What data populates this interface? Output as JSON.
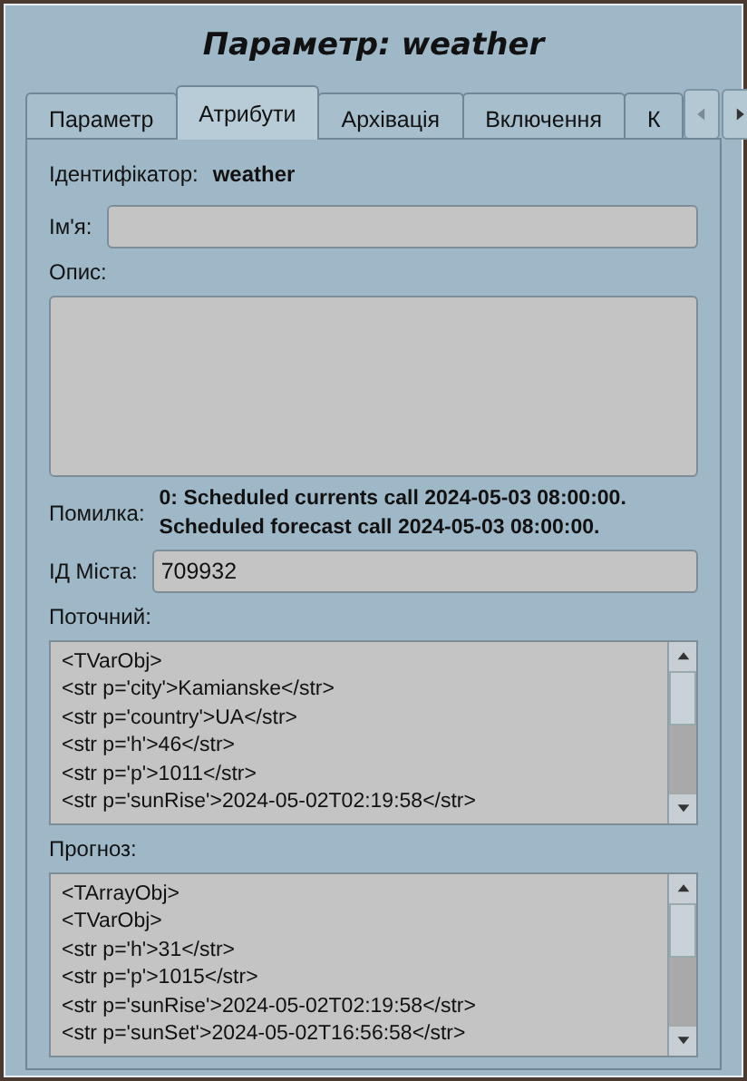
{
  "window": {
    "title": "Параметр: weather"
  },
  "tabs": [
    {
      "label": "Параметр",
      "selected": false
    },
    {
      "label": "Атрибути",
      "selected": true
    },
    {
      "label": "Архівація",
      "selected": false
    },
    {
      "label": "Включення",
      "selected": false
    },
    {
      "label": "К",
      "selected": false
    }
  ],
  "identifier": {
    "label": "Ідентифікатор:",
    "value": "weather"
  },
  "name": {
    "label": "Ім'я:"
  },
  "description": {
    "label": "Опис:"
  },
  "error": {
    "label": "Помилка:",
    "lines": [
      "0: Scheduled currents call 2024-05-03 08:00:00.",
      "Scheduled forecast call 2024-05-03 08:00:00."
    ]
  },
  "city_id": {
    "label": "ІД Міста:",
    "value": "709932"
  },
  "current": {
    "label": "Поточний:",
    "lines": [
      "<TVarObj>",
      "<str p='city'>Kamianske</str>",
      "<str p='country'>UA</str>",
      "<str p='h'>46</str>",
      "<str p='p'>1011</str>",
      "<str p='sunRise'>2024-05-02T02:19:58</str>"
    ]
  },
  "forecast": {
    "label": "Прогноз:",
    "lines": [
      "<TArrayObj>",
      "<TVarObj>",
      "<str p='h'>31</str>",
      "<str p='p'>1015</str>",
      "<str p='sunRise'>2024-05-02T02:19:58</str>",
      "<str p='sunSet'>2024-05-02T16:56:58</str>"
    ]
  }
}
